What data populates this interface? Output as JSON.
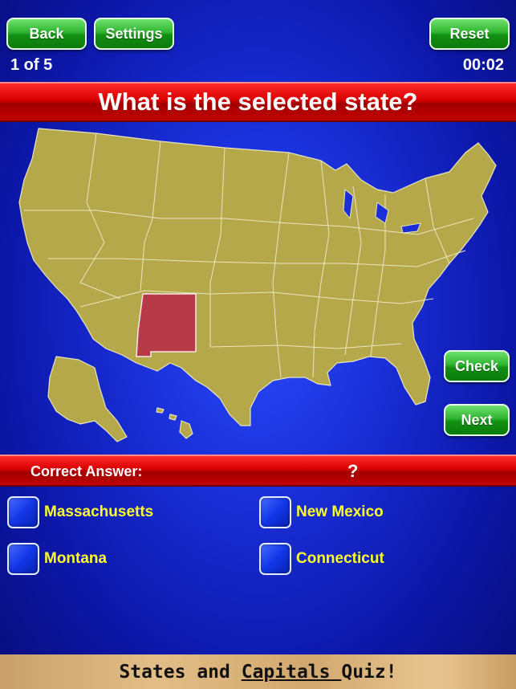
{
  "header": {
    "back_label": "Back",
    "settings_label": "Settings",
    "reset_label": "Reset",
    "progress": "1 of 5",
    "timer": "00:02"
  },
  "question": "What is the selected state?",
  "map": {
    "selected_state": "New Mexico",
    "land_color": "#b5a84a",
    "selected_color": "#b83a48",
    "border_color": "#e8e6c0"
  },
  "actions": {
    "check_label": "Check",
    "next_label": "Next"
  },
  "answer": {
    "label": "Correct Answer:",
    "value": "?"
  },
  "choices": [
    {
      "label": "Massachusetts"
    },
    {
      "label": "New Mexico"
    },
    {
      "label": "Montana"
    },
    {
      "label": "Connecticut"
    }
  ],
  "footer": {
    "part1": "States and ",
    "part2": "Capitals ",
    "part3": "Quiz!"
  }
}
